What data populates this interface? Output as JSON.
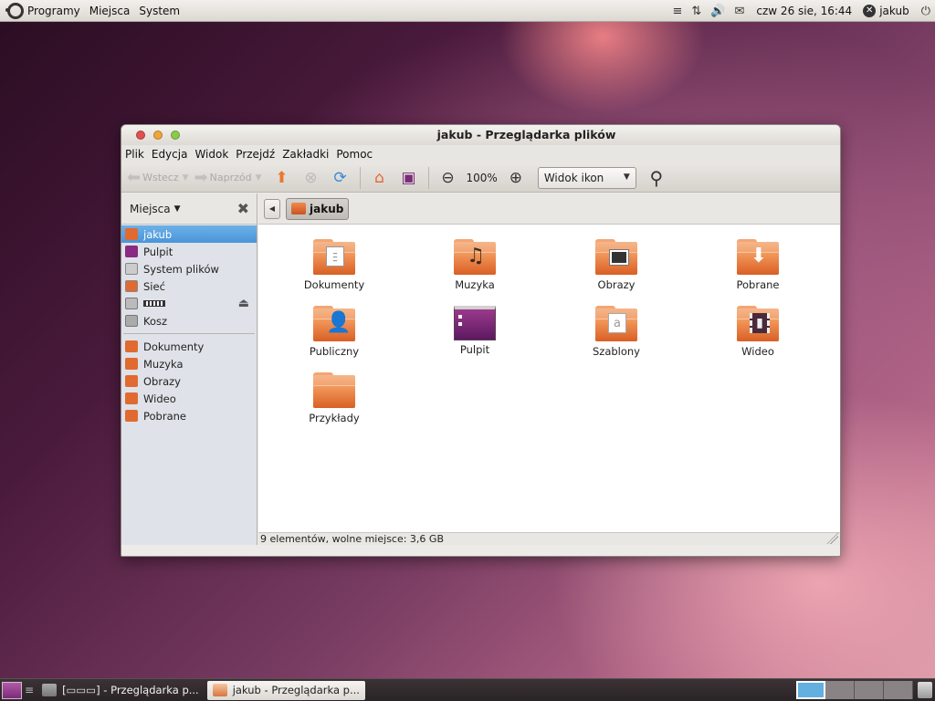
{
  "top_panel": {
    "menus": [
      "Programy",
      "Miejsca",
      "System"
    ],
    "clock": "czw 26 sie, 16:44",
    "user": "jakub"
  },
  "window": {
    "title": "jakub - Przeglądarka plików",
    "menubar": [
      "Plik",
      "Edycja",
      "Widok",
      "Przejdź",
      "Zakładki",
      "Pomoc"
    ],
    "toolbar": {
      "back_label": "Wstecz",
      "forward_label": "Naprzód",
      "zoom": "100%",
      "view_mode": "Widok ikon"
    },
    "sidebar": {
      "header": "Miejsca",
      "places": [
        {
          "label": "jakub",
          "icon": "home-folder-icon",
          "color": "#e06a30",
          "active": true
        },
        {
          "label": "Pulpit",
          "icon": "desktop-icon",
          "color": "#8a2a82",
          "active": false
        },
        {
          "label": "System plików",
          "icon": "filesystem-icon",
          "color": "#cccccc",
          "active": false
        },
        {
          "label": "Sieć",
          "icon": "network-icon",
          "color": "#e06a30",
          "active": false
        },
        {
          "label": "",
          "icon": "drive-icon",
          "color": "#bbbbbb",
          "active": false,
          "eject": true
        },
        {
          "label": "Kosz",
          "icon": "trash-icon",
          "color": "#aaaaaa",
          "active": false
        }
      ],
      "bookmarks": [
        {
          "label": "Dokumenty",
          "icon": "documents-folder-icon",
          "color": "#e06a30"
        },
        {
          "label": "Muzyka",
          "icon": "music-folder-icon",
          "color": "#e06a30"
        },
        {
          "label": "Obrazy",
          "icon": "pictures-folder-icon",
          "color": "#e06a30"
        },
        {
          "label": "Wideo",
          "icon": "videos-folder-icon",
          "color": "#e06a30"
        },
        {
          "label": "Pobrane",
          "icon": "downloads-folder-icon",
          "color": "#e06a30"
        }
      ]
    },
    "path": {
      "current": "jakub"
    },
    "items": [
      {
        "label": "Dokumenty",
        "kind": "doc"
      },
      {
        "label": "Muzyka",
        "kind": "music"
      },
      {
        "label": "Obrazy",
        "kind": "pics"
      },
      {
        "label": "Pobrane",
        "kind": "down"
      },
      {
        "label": "Publiczny",
        "kind": "person"
      },
      {
        "label": "Pulpit",
        "kind": "desktop"
      },
      {
        "label": "Szablony",
        "kind": "tmpl"
      },
      {
        "label": "Wideo",
        "kind": "video"
      },
      {
        "label": "Przykłady",
        "kind": "plain"
      }
    ],
    "status": "9 elementów, wolne miejsce: 3,6 GB"
  },
  "bottom_panel": {
    "tasks": [
      {
        "label": "[▭▭▭] - Przeglądarka p...",
        "active": false
      },
      {
        "label": "jakub - Przeglądarka p...",
        "active": true
      }
    ]
  }
}
